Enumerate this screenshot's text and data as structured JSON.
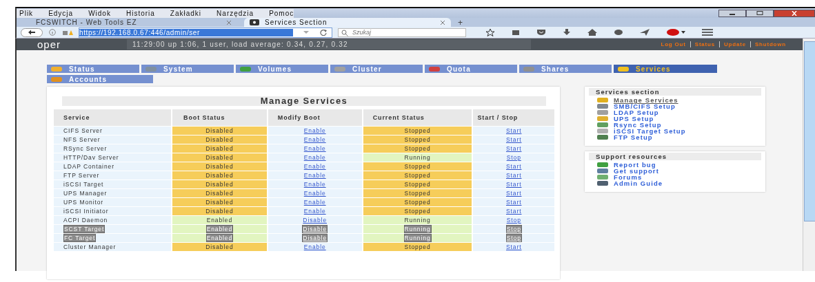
{
  "menu": [
    "Plik",
    "Edycja",
    "Widok",
    "Historia",
    "Zakładki",
    "Narzędzia",
    "Pomoc"
  ],
  "browser_tabs": [
    {
      "title": "FCSWITCH - Web Tools EZ",
      "selected": false
    },
    {
      "title": "Services Section",
      "selected": true
    }
  ],
  "new_tab": "+",
  "address": {
    "url": "https://192.168.0.67:446/admin/ser",
    "search_placeholder": "Szukaj"
  },
  "header": {
    "logo": "oper",
    "uptime": "11:29:00 up 1:06, 1 user, load average: 0.34, 0.27, 0.32",
    "links": [
      "Log Out",
      "Status",
      "Update",
      "Shutdown"
    ]
  },
  "nav_tabs": [
    {
      "label": "Status",
      "selected": false,
      "color": "#f0b030"
    },
    {
      "label": "System",
      "selected": false,
      "color": "#8090a0"
    },
    {
      "label": "Volumes",
      "selected": false,
      "color": "#40a040"
    },
    {
      "label": "Cluster",
      "selected": false,
      "color": "#a0a0a0"
    },
    {
      "label": "Quota",
      "selected": false,
      "color": "#d04040"
    },
    {
      "label": "Shares",
      "selected": false,
      "color": "#909090"
    },
    {
      "label": "Services",
      "selected": true,
      "color": "#f0c020"
    },
    {
      "label": "Accounts",
      "selected": false,
      "color": "#e09020"
    }
  ],
  "table": {
    "title": "Manage Services",
    "columns": [
      "Service",
      "Boot Status",
      "Modify Boot",
      "Current Status",
      "Start / Stop"
    ],
    "rows": [
      {
        "service": "CIFS Server",
        "boot": "Disabled",
        "boot_enabled": false,
        "modify": "Enable",
        "current": "Stopped",
        "running": false,
        "action": "Start",
        "disabled": false
      },
      {
        "service": "NFS Server",
        "boot": "Disabled",
        "boot_enabled": false,
        "modify": "Enable",
        "current": "Stopped",
        "running": false,
        "action": "Start",
        "disabled": false
      },
      {
        "service": "RSync Server",
        "boot": "Disabled",
        "boot_enabled": false,
        "modify": "Enable",
        "current": "Stopped",
        "running": false,
        "action": "Start",
        "disabled": false
      },
      {
        "service": "HTTP/Dav Server",
        "boot": "Disabled",
        "boot_enabled": false,
        "modify": "Enable",
        "current": "Running",
        "running": true,
        "action": "Stop",
        "disabled": false
      },
      {
        "service": "LDAP Container",
        "boot": "Disabled",
        "boot_enabled": false,
        "modify": "Enable",
        "current": "Stopped",
        "running": false,
        "action": "Start",
        "disabled": false
      },
      {
        "service": "FTP Server",
        "boot": "Disabled",
        "boot_enabled": false,
        "modify": "Enable",
        "current": "Stopped",
        "running": false,
        "action": "Start",
        "disabled": false
      },
      {
        "service": "iSCSI Target",
        "boot": "Disabled",
        "boot_enabled": false,
        "modify": "Enable",
        "current": "Stopped",
        "running": false,
        "action": "Start",
        "disabled": false
      },
      {
        "service": "UPS Manager",
        "boot": "Disabled",
        "boot_enabled": false,
        "modify": "Enable",
        "current": "Stopped",
        "running": false,
        "action": "Start",
        "disabled": false
      },
      {
        "service": "UPS Monitor",
        "boot": "Disabled",
        "boot_enabled": false,
        "modify": "Enable",
        "current": "Stopped",
        "running": false,
        "action": "Start",
        "disabled": false
      },
      {
        "service": "iSCSI Initiator",
        "boot": "Disabled",
        "boot_enabled": false,
        "modify": "Enable",
        "current": "Stopped",
        "running": false,
        "action": "Start",
        "disabled": false
      },
      {
        "service": "ACPI Daemon",
        "boot": "Enabled",
        "boot_enabled": true,
        "modify": "Disable",
        "current": "Running",
        "running": true,
        "action": "Stop",
        "disabled": false
      },
      {
        "service": "SCST Target",
        "boot": "Enabled",
        "boot_enabled": true,
        "modify": "Disable",
        "current": "Running",
        "running": true,
        "action": "Stop",
        "disabled": true
      },
      {
        "service": "FC Target",
        "boot": "Enabled",
        "boot_enabled": true,
        "modify": "Disable",
        "current": "Running",
        "running": true,
        "action": "Stop",
        "disabled": true
      },
      {
        "service": "Cluster Manager",
        "boot": "Disabled",
        "boot_enabled": false,
        "modify": "Enable",
        "current": "Stopped",
        "running": false,
        "action": "Start",
        "disabled": false
      }
    ]
  },
  "sidebar": [
    {
      "title": "Services section",
      "links": [
        {
          "label": "Manage Services",
          "selected": true,
          "color": "#e0b020"
        },
        {
          "label": "SMB/CIFS Setup",
          "selected": false,
          "color": "#808890"
        },
        {
          "label": "LDAP Setup",
          "selected": false,
          "color": "#a0a0a0"
        },
        {
          "label": "UPS Setup",
          "selected": false,
          "color": "#e0b030"
        },
        {
          "label": "Rsync Setup",
          "selected": false,
          "color": "#60a060"
        },
        {
          "label": "iSCSI Target Setup",
          "selected": false,
          "color": "#b0b0b0"
        },
        {
          "label": "FTP Setup",
          "selected": false,
          "color": "#508050"
        }
      ]
    },
    {
      "title": "Support resources",
      "links": [
        {
          "label": "Report bug",
          "selected": false,
          "color": "#40a040"
        },
        {
          "label": "Get support",
          "selected": false,
          "color": "#6080a0"
        },
        {
          "label": "Forums",
          "selected": false,
          "color": "#70b070"
        },
        {
          "label": "Admin Guide",
          "selected": false,
          "color": "#506070"
        }
      ]
    }
  ]
}
